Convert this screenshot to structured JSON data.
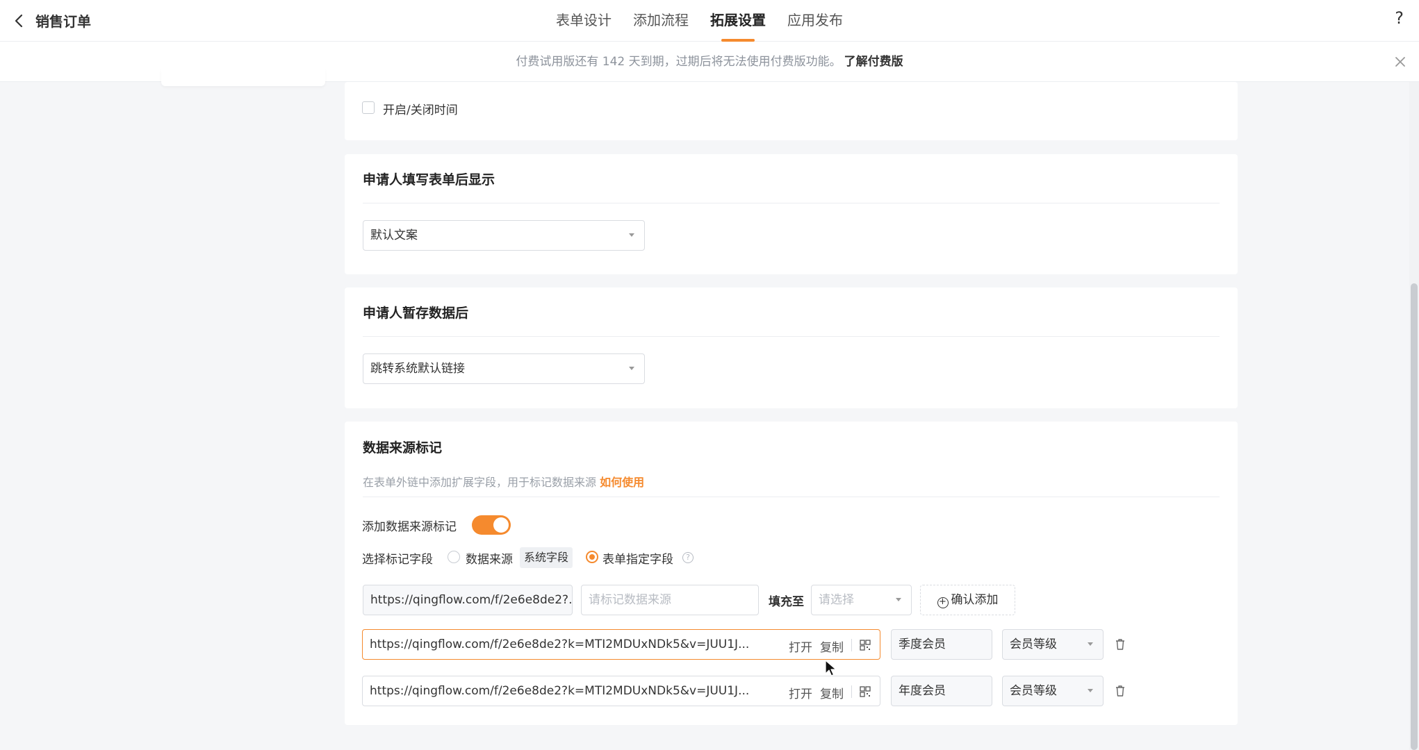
{
  "header": {
    "title": "销售订单",
    "tabs": [
      {
        "label": "表单设计"
      },
      {
        "label": "添加流程"
      },
      {
        "label": "拓展设置",
        "active": true
      },
      {
        "label": "应用发布"
      }
    ],
    "help": "?"
  },
  "notice": {
    "text": "付费试用版还有 142 天到期，过期后将无法使用付费版功能。",
    "link": "了解付费版"
  },
  "time_card": {
    "checkbox_label": "开启/关闭时间"
  },
  "after_fill_card": {
    "title": "申请人填写表单后显示",
    "select_value": "默认文案"
  },
  "after_save_card": {
    "title": "申请人暂存数据后",
    "select_value": "跳转系统默认链接"
  },
  "source_card": {
    "title": "数据来源标记",
    "hint": "在表单外链中添加扩展字段，用于标记数据来源",
    "hint_link": "如何使用",
    "toggle_label": "添加数据来源标记",
    "toggle_on": true,
    "field_label": "选择标记字段",
    "radio_data_source": "数据来源",
    "system_tag": "系统字段",
    "radio_form_field": "表单指定字段",
    "new_row": {
      "url": "https://qingflow.com/f/2e6e8de2?...",
      "source_placeholder": "请标记数据来源",
      "fill_label": "填充至",
      "select_placeholder": "请选择",
      "add_button": "确认添加"
    },
    "rows": [
      {
        "url": "https://qingflow.com/f/2e6e8de2?k=MTI2MDUxNDk5&v=JUU1J...",
        "open": "打开",
        "copy": "复制",
        "source": "季度会员",
        "field": "会员等级"
      },
      {
        "url": "https://qingflow.com/f/2e6e8de2?k=MTI2MDUxNDk5&v=JUU1J...",
        "open": "打开",
        "copy": "复制",
        "source": "年度会员",
        "field": "会员等级"
      }
    ]
  },
  "colors": {
    "accent": "#f58a2e",
    "background": "#f5f6f8"
  }
}
